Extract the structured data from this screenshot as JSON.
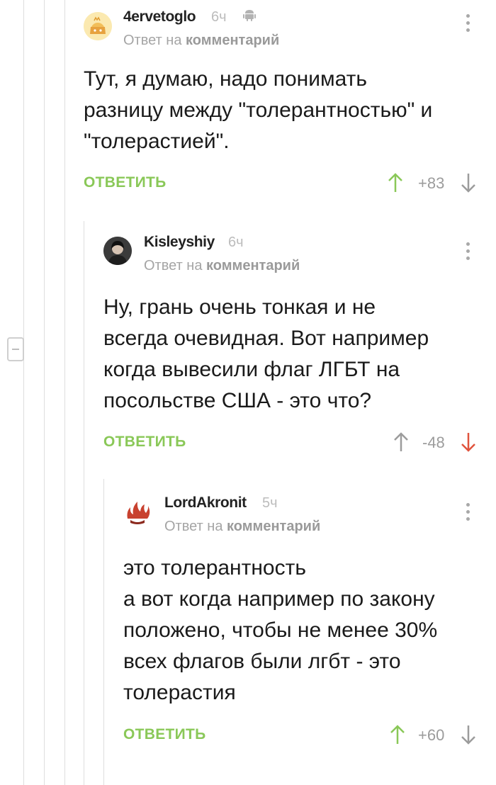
{
  "comments": [
    {
      "username": "4ervetoglo",
      "time": "6ч",
      "reply_prefix": "Ответ на",
      "reply_target": "комментарий",
      "text": "Тут, я думаю, надо понимать\nразницу между \"толерантностью\" и\n\"толерастией\".",
      "reply_label": "ОТВЕТИТЬ",
      "rating": "+83",
      "platform_icon": "android-icon",
      "vote": "up"
    },
    {
      "username": "Kisleyshiy",
      "time": "6ч",
      "reply_prefix": "Ответ на",
      "reply_target": "комментарий",
      "text": "Ну, грань очень тонкая и не\nвсегда очевидная. Вот например\nкогда вывесили флаг ЛГБТ на\nпосольстве США - это что?",
      "reply_label": "ОТВЕТИТЬ",
      "rating": "-48",
      "vote": "down"
    },
    {
      "username": "LordAkronit",
      "time": "5ч",
      "reply_prefix": "Ответ на",
      "reply_target": "комментарий",
      "text": "это толерантность\nа вот когда например по закону\nположено, чтобы не менее 30%\nвсех флагов были лгбт   - это\nтолерастия",
      "reply_label": "ОТВЕТИТЬ",
      "rating": "+60",
      "vote": "up"
    }
  ],
  "colors": {
    "accent_green": "#8ac858",
    "vote_down_red": "#e0533d",
    "muted_gray": "#a5a5a5"
  }
}
